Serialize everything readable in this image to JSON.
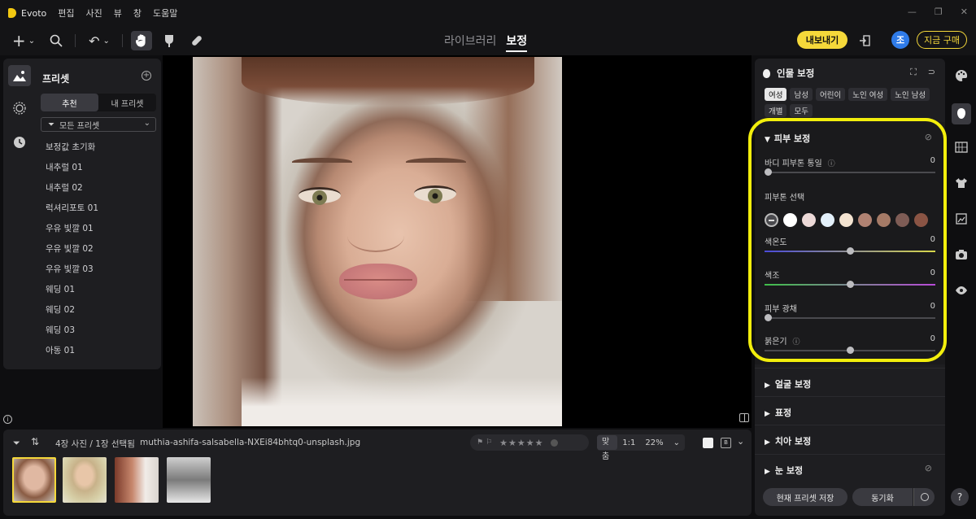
{
  "app": {
    "name": "Evoto",
    "menu": [
      "편집",
      "사진",
      "뷰",
      "창",
      "도움말"
    ]
  },
  "toolbar": {
    "tabs": {
      "library": "라이브러리",
      "edit": "보정"
    },
    "export_label": "내보내기",
    "avatar_initial": "조",
    "buy_label": "지금 구매"
  },
  "presets": {
    "title": "프리셋",
    "tabs": {
      "recommended": "추천",
      "mine": "내 프리셋"
    },
    "filter": "모든 프리셋",
    "items": [
      "보정값 초기화",
      "내추럴 01",
      "내추럴 02",
      "럭셔리포토 01",
      "우유 빛깔 01",
      "우유 빛깔 02",
      "우유 빛깔 03",
      "웨딩 01",
      "웨딩 02",
      "웨딩 03",
      "아동 01"
    ]
  },
  "filmstrip": {
    "count": "4장 사진 / 1장 선택됨",
    "filename": "muthia-ashifa-salsabella-NXEi84bhtq0-unsplash.jpg",
    "zoom_fit": "맞춤",
    "zoom_1to1": "1:1",
    "zoom_pct": "22%",
    "stars": "★★★★★"
  },
  "portrait": {
    "title": "인물 보정",
    "chips": [
      "여성",
      "남성",
      "어린이",
      "노인 여성",
      "노인 남성",
      "개별",
      "모두"
    ],
    "selected_chip": "여성",
    "skin": {
      "title": "피부 보정",
      "sliders": [
        {
          "label": "바디 피부톤 통일",
          "value": "0",
          "level": 0
        },
        {
          "label": "색온도",
          "value": "0",
          "level": 0.5
        },
        {
          "label": "색조",
          "value": "0",
          "level": 0.5
        },
        {
          "label": "피부 광채",
          "value": "0",
          "level": 0
        },
        {
          "label": "붉은기",
          "value": "0",
          "level": 0.5
        }
      ],
      "tone_label": "피부톤 선택",
      "swatches": [
        "#ffffff",
        "#ecd9d7",
        "#e3f0fa",
        "#f4e4d1",
        "#b08272",
        "#a57a66",
        "#7e5c55",
        "#8a5444"
      ]
    },
    "sections": [
      "얼굴 보정",
      "표정",
      "치아 보정",
      "눈 보정"
    ],
    "save_preset": "현재 프리셋 저장",
    "sync": "동기화"
  },
  "colors": {
    "accent": "#f5d83a",
    "highlight": "#f2ee0c",
    "avatar": "#2f7be8"
  }
}
